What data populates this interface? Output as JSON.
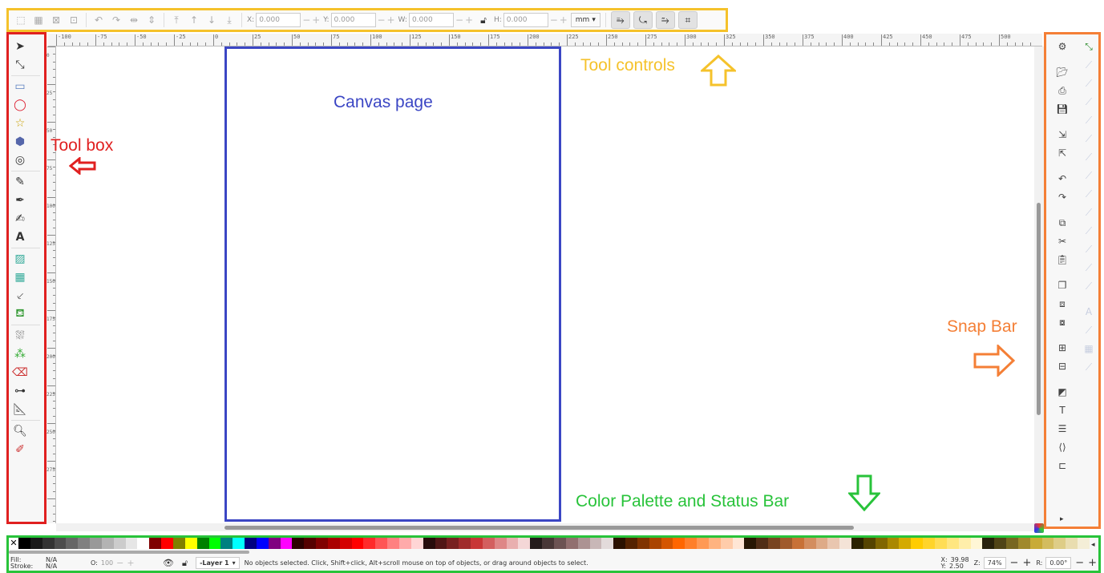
{
  "annotations": {
    "tool_controls": "Tool controls",
    "tool_box": "Tool box",
    "canvas_page": "Canvas page",
    "snap_bar": "Snap Bar",
    "palette_status": "Color Palette and Status Bar"
  },
  "colors": {
    "tool_controls": "#f5c22b",
    "tool_box": "#e02020",
    "canvas_page": "#3b46c4",
    "snap_bar": "#f47f36",
    "palette_status": "#28c33a"
  },
  "tool_controls": {
    "x_label": "X:",
    "x_value": "0.000",
    "y_label": "Y:",
    "y_value": "0.000",
    "w_label": "W:",
    "w_value": "0.000",
    "h_label": "H:",
    "h_value": "0.000",
    "unit": "mm"
  },
  "ruler_top_labels": [
    "-100",
    "-75",
    "-50",
    "-25",
    "0",
    "25",
    "50",
    "75",
    "100",
    "125",
    "150",
    "175",
    "200",
    "225",
    "250",
    "275",
    "300",
    "325",
    "350",
    "375",
    "400",
    "425",
    "450",
    "475",
    "500"
  ],
  "ruler_left_labels": [
    "0",
    "25",
    "50",
    "75",
    "100",
    "125",
    "150",
    "175",
    "200",
    "225",
    "250",
    "275"
  ],
  "tools": [
    "selector-tool-icon",
    "node-tool-icon",
    "rectangle-tool-icon",
    "ellipse-tool-icon",
    "star-tool-icon",
    "3d-box-tool-icon",
    "spiral-tool-icon",
    "pencil-tool-icon",
    "pen-tool-icon",
    "calligraphy-tool-icon",
    "text-tool-icon",
    "gradient-tool-icon",
    "mesh-tool-icon",
    "dropper-tool-icon",
    "paint-bucket-tool-icon",
    "tweak-tool-icon",
    "spray-tool-icon",
    "eraser-tool-icon",
    "connector-tool-icon",
    "measure-tool-icon",
    "zoom-tool-icon",
    "lpe-tool-icon"
  ],
  "status": {
    "fill_label": "Fill:",
    "fill_value": "N/A",
    "stroke_label": "Stroke:",
    "stroke_value": "N/A",
    "opacity_label": "O:",
    "opacity_value": "100",
    "layer": "-Layer 1",
    "message": "No objects selected. Click, Shift+click, Alt+scroll mouse on top of objects, or drag around objects to select.",
    "x_label": "X:",
    "x_value": "39.98",
    "y_label": "Y:",
    "y_value": "2.50",
    "z_label": "Z:",
    "zoom": "74%",
    "r_label": "R:",
    "rotation": "0.00°"
  },
  "palette": [
    "#000000",
    "#1a1a1a",
    "#333333",
    "#4d4d4d",
    "#666666",
    "#808080",
    "#999999",
    "#b3b3b3",
    "#cccccc",
    "#e6e6e6",
    "#ffffff",
    "#800000",
    "#ff0000",
    "#808000",
    "#ffff00",
    "#008000",
    "#00ff00",
    "#008080",
    "#00ffff",
    "#000080",
    "#0000ff",
    "#800080",
    "#ff00ff",
    "#2b0000",
    "#550000",
    "#800000",
    "#aa0000",
    "#d40000",
    "#ff0000",
    "#ff2a2a",
    "#ff5555",
    "#ff8080",
    "#ffaaaa",
    "#ffd5d5",
    "#280b0b",
    "#501616",
    "#782121",
    "#a02c2c",
    "#c83737",
    "#d35f5f",
    "#de8787",
    "#e9afaf",
    "#f4d7d7",
    "#241c1c",
    "#483737",
    "#6c5353",
    "#916f6f",
    "#ac9393",
    "#c8b7b7",
    "#e3dbdb",
    "#2b1100",
    "#552200",
    "#803300",
    "#aa4400",
    "#d45500",
    "#ff6600",
    "#ff7f2a",
    "#ff9955",
    "#ffb380",
    "#ffccaa",
    "#ffe6d5",
    "#281704",
    "#502d16",
    "#784421",
    "#a05a2c",
    "#c87137",
    "#d38d5f",
    "#deaa87",
    "#e9c6af",
    "#f4e3d7",
    "#2b2200",
    "#554400",
    "#806600",
    "#aa8800",
    "#d4aa00",
    "#ffcc00",
    "#ffd42a",
    "#ffdd55",
    "#ffe680",
    "#ffeeaa",
    "#fff6d5",
    "#28220b",
    "#504416",
    "#786721",
    "#a0892c",
    "#c8ab37",
    "#d3bc5f",
    "#decd87",
    "#e9ddaf",
    "#f4eed7"
  ],
  "snap_left": [
    "document-properties-icon",
    "open-icon",
    "print-icon",
    "save-icon",
    "import-icon",
    "export-icon",
    "undo-icon",
    "redo-icon",
    "copy-icon",
    "cut-icon",
    "paste-icon",
    "duplicate-icon",
    "clone-icon",
    "unlink-clone-icon",
    "group-icon",
    "ungroup-icon",
    "fill-stroke-icon",
    "text-font-icon",
    "layers-icon",
    "xml-editor-icon",
    "align-icon"
  ],
  "snap_right": [
    "snap-toggle-icon",
    "snap-bbox-icon",
    "snap-bbox-edge-icon",
    "snap-bbox-corner-icon",
    "snap-bbox-midpoint-icon",
    "snap-bbox-center-icon",
    "snap-nodes-icon",
    "snap-path-icon",
    "snap-intersection-icon",
    "snap-cusp-icon",
    "snap-smooth-icon",
    "snap-midpoint-icon",
    "snap-center-icon",
    "snap-rotation-center-icon",
    "snap-text-baseline-icon",
    "snap-page-border-icon",
    "snap-grid-icon",
    "snap-guide-icon"
  ]
}
